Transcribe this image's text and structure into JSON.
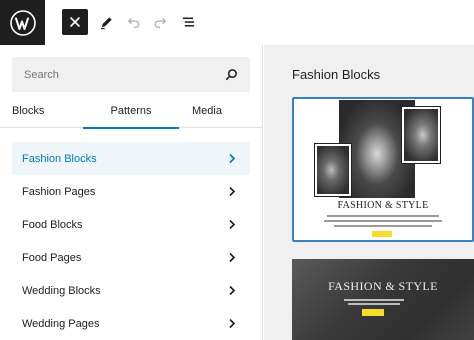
{
  "toolbar": {
    "logo_icon": "wordpress-icon",
    "close_icon": "close-icon",
    "tools_icon": "pencil-icon",
    "undo_icon": "undo-icon",
    "redo_icon": "redo-icon",
    "outline_icon": "list-view-icon"
  },
  "inserter": {
    "search": {
      "placeholder": "Search",
      "value": ""
    },
    "tabs": [
      {
        "label": "Blocks"
      },
      {
        "label": "Patterns",
        "active": true
      },
      {
        "label": "Media"
      }
    ],
    "categories": [
      {
        "label": "Fashion Blocks",
        "selected": true
      },
      {
        "label": "Fashion Pages"
      },
      {
        "label": "Food Blocks"
      },
      {
        "label": "Food Pages"
      },
      {
        "label": "Wedding Blocks"
      },
      {
        "label": "Wedding Pages"
      }
    ],
    "accent_color": "#007cba"
  },
  "preview": {
    "title": "Fashion Blocks",
    "patterns": [
      {
        "heading": "FASHION & STYLE"
      },
      {
        "heading": "FASHION & STYLE"
      }
    ],
    "button_color": "#f5dd2e"
  }
}
